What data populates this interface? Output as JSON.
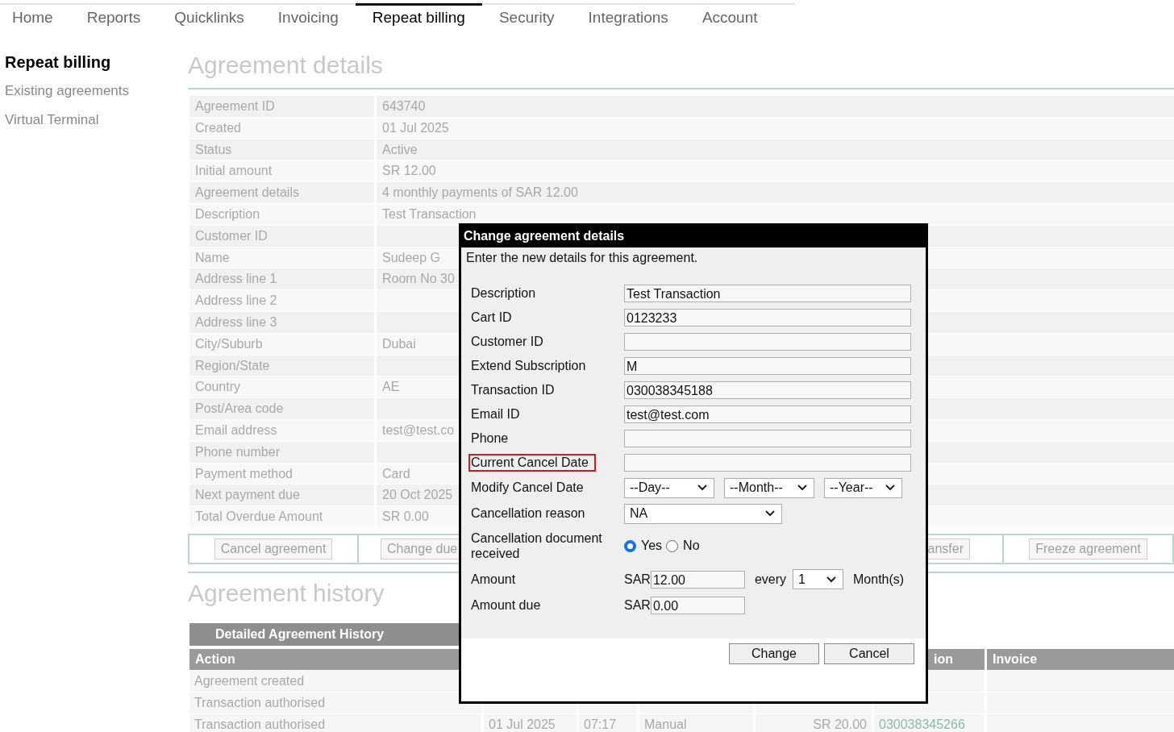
{
  "nav": {
    "tabs": [
      {
        "label": "Home",
        "selected": false
      },
      {
        "label": "Reports",
        "selected": false
      },
      {
        "label": "Quicklinks",
        "selected": false
      },
      {
        "label": "Invoicing",
        "selected": false
      },
      {
        "label": "Repeat billing",
        "selected": true
      },
      {
        "label": "Security",
        "selected": false
      },
      {
        "label": "Integrations",
        "selected": false
      },
      {
        "label": "Account",
        "selected": false
      }
    ]
  },
  "sidebar": {
    "title": "Repeat billing",
    "items": [
      "Existing agreements",
      "Virtual Terminal"
    ]
  },
  "details": {
    "heading": "Agreement details",
    "rows": [
      {
        "label": "Agreement ID",
        "value": "643740"
      },
      {
        "label": "Created",
        "value": "01 Jul 2025"
      },
      {
        "label": "Status",
        "value": "Active"
      },
      {
        "label": "Initial amount",
        "value": "SR 12.00"
      },
      {
        "label": "Agreement details",
        "value": "4 monthly payments of SAR 12.00"
      },
      {
        "label": "Description",
        "value": "Test Transaction"
      },
      {
        "label": "Customer ID"
      },
      {
        "label": "Name",
        "value": "Sudeep G"
      },
      {
        "label": "Address line 1",
        "value": "Room No 30"
      },
      {
        "label": "Address line 2"
      },
      {
        "label": "Address line 3"
      },
      {
        "label": "City/Suburb",
        "value": "Dubai"
      },
      {
        "label": "Region/State"
      },
      {
        "label": "Country",
        "value": "AE"
      },
      {
        "label": "Post/Area code"
      },
      {
        "label": "Email address",
        "value": "test@test.co"
      },
      {
        "label": "Phone number"
      },
      {
        "label": "Payment method",
        "value": "Card"
      },
      {
        "label": "Next payment due",
        "value": "20 Oct 2025"
      },
      {
        "label": "Total Overdue Amount",
        "value": "SR 0.00"
      }
    ]
  },
  "actions": [
    "Cancel agreement",
    "Change due",
    "ansfer",
    "Freeze agreement"
  ],
  "history": {
    "heading": "Agreement history",
    "band_title": "Detailed Agreement History",
    "columns": [
      "Action",
      "ion",
      "Invoice"
    ],
    "rows": [
      {
        "action": "Agreement created"
      },
      {
        "action": "Transaction authorised"
      },
      {
        "action": "Transaction authorised",
        "date": "01 Jul 2025",
        "time": "07:17",
        "type": "Manual",
        "amount": "SR 20.00",
        "transaction": "030038345266"
      }
    ]
  },
  "dialog": {
    "title": "Change agreement details",
    "intro": "Enter the new details for this agreement.",
    "fields": [
      {
        "kind": "text",
        "label": "Description",
        "value": "Test Transaction",
        "highlighted": false
      },
      {
        "kind": "text",
        "label": "Cart ID",
        "value": "0123233",
        "highlighted": false
      },
      {
        "kind": "text",
        "label": "Customer ID",
        "highlighted": false
      },
      {
        "kind": "text",
        "label": "Extend Subscription",
        "value": "M",
        "highlighted": false
      },
      {
        "kind": "text",
        "label": "Transaction ID",
        "value": "030038345188",
        "highlighted": false
      },
      {
        "kind": "text",
        "label": "Email ID",
        "value": "test@test.com",
        "highlighted": false
      },
      {
        "kind": "text",
        "label": "Phone",
        "highlighted": false
      },
      {
        "kind": "text",
        "label": "Current Cancel Date",
        "highlighted": true
      },
      {
        "kind": "date",
        "label": "Modify Cancel Date",
        "selects": [
          "--Day--",
          "--Month--",
          "--Year--"
        ]
      },
      {
        "kind": "select",
        "label": "Cancellation reason",
        "value": "NA"
      },
      {
        "kind": "radio",
        "label": "Cancellation document received",
        "options": [
          {
            "label": "Yes",
            "selected": true
          },
          {
            "label": "No",
            "selected": false
          }
        ]
      },
      {
        "kind": "amount",
        "label": "Amount",
        "currency": "SAR",
        "value": "12.00",
        "every_label": "every",
        "period": "1",
        "unit": "Month(s)"
      },
      {
        "kind": "amount",
        "label": "Amount due",
        "currency": "SAR",
        "value": "0.00"
      }
    ],
    "buttons": [
      "Change",
      "Cancel"
    ]
  }
}
